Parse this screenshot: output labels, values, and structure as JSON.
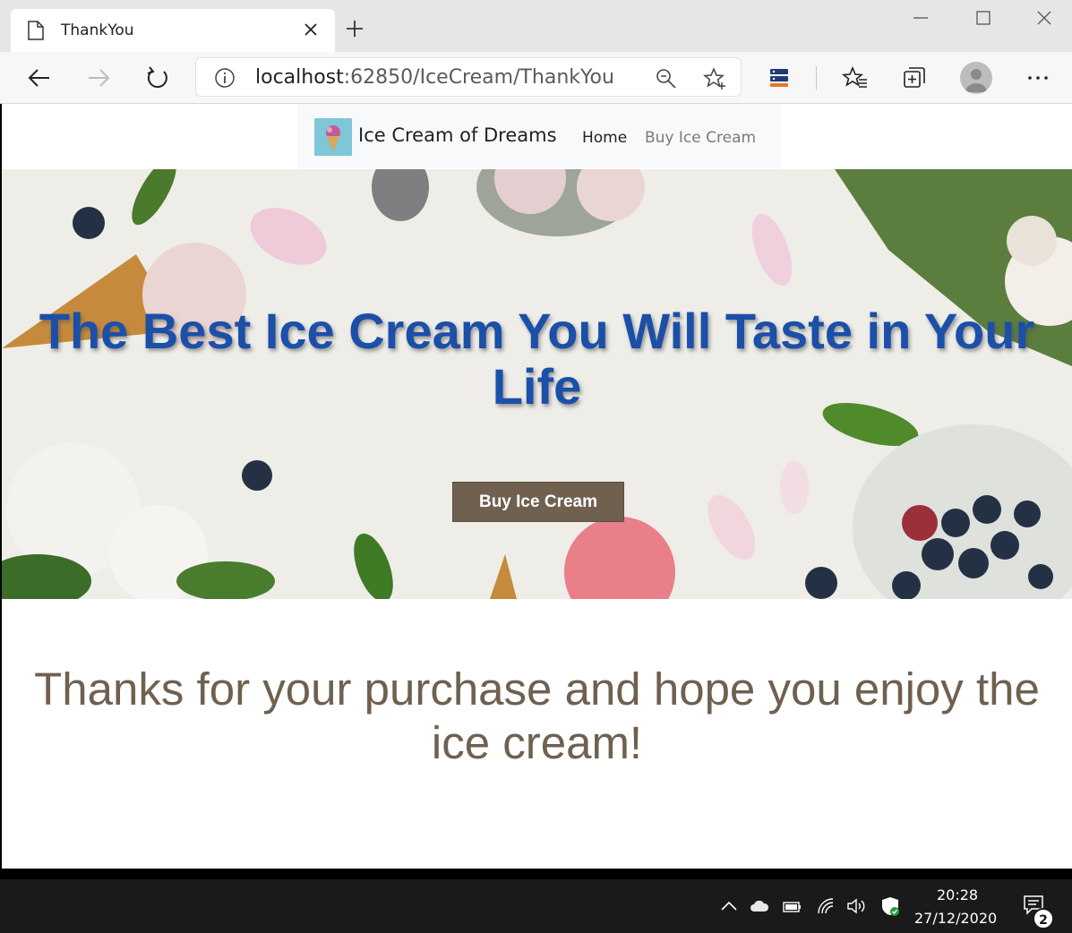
{
  "browser": {
    "tab_title": "ThankYou",
    "url_host": "localhost",
    "url_rest": ":62850/IceCream/ThankYou",
    "icons": [
      "page-icon",
      "close-icon",
      "new-tab-icon",
      "minimize-icon",
      "maximize-icon",
      "close-window-icon",
      "back-icon",
      "forward-icon",
      "refresh-icon",
      "info-icon",
      "zoom-icon",
      "favorite-add-icon",
      "extension-icon",
      "favorites-icon",
      "collections-icon",
      "profile-avatar",
      "more-icon"
    ]
  },
  "site": {
    "brand": "Ice Cream of Dreams",
    "nav": {
      "home": "Home",
      "buy": "Buy Ice Cream"
    },
    "hero": {
      "title": "The Best Ice Cream You Will Taste in Your Life",
      "button": "Buy Ice Cream"
    },
    "thanks": "Thanks for your purchase and hope you enjoy the ice cream!",
    "colors": {
      "hero_title": "#1b4fa8",
      "accent": "#6f6050",
      "nav_bg": "#f8f9fa"
    }
  },
  "taskbar": {
    "time": "20:28",
    "date": "27/12/2020",
    "notifications": "2",
    "icons": [
      "chevron-up-icon",
      "cloud-icon",
      "battery-icon",
      "wifi-icon",
      "volume-icon",
      "security-icon",
      "notification-icon"
    ]
  }
}
